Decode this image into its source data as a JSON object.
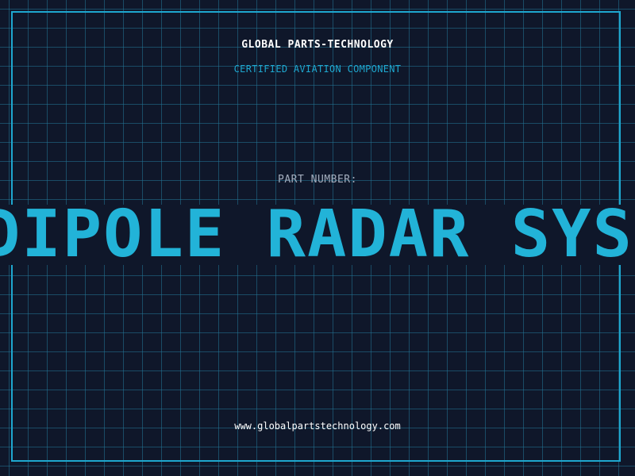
{
  "header": {
    "company": "GLOBAL PARTS-TECHNOLOGY",
    "subtitle": "CERTIFIED AVIATION COMPONENT"
  },
  "part": {
    "label": "PART NUMBER:",
    "value": "DIPOLE RADAR SYSTEM"
  },
  "footer": {
    "website": "www.globalpartstechnology.com"
  },
  "colors": {
    "background": "#0f172a",
    "accent": "#22b3d8",
    "grid": "#227696",
    "label": "#a3adbd",
    "text": "#ffffff"
  }
}
